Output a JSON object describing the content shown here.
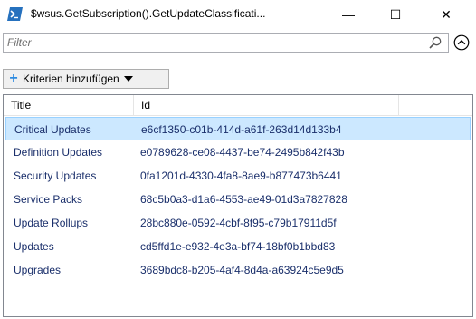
{
  "window": {
    "title": "$wsus.GetSubscription().GetUpdateClassificati...",
    "minimize_glyph": "—",
    "maximize_glyph": "☐",
    "close_glyph": "✕"
  },
  "filter": {
    "placeholder": "Filter",
    "value": "",
    "search_icon": "search-icon",
    "collapse_icon": "chevron-up-circle-icon"
  },
  "criteria": {
    "label": "Kriterien hinzufügen",
    "icon": "plus-icon",
    "plus_glyph": "+"
  },
  "grid": {
    "columns": [
      "Title",
      "Id",
      ""
    ],
    "rows": [
      {
        "title": "Critical Updates",
        "id": "e6cf1350-c01b-414d-a61f-263d14d133b4",
        "selected": true
      },
      {
        "title": "Definition Updates",
        "id": "e0789628-ce08-4437-be74-2495b842f43b",
        "selected": false
      },
      {
        "title": "Security Updates",
        "id": "0fa1201d-4330-4fa8-8ae9-b877473b6441",
        "selected": false
      },
      {
        "title": "Service Packs",
        "id": "68c5b0a3-d1a6-4553-ae49-01d3a7827828",
        "selected": false
      },
      {
        "title": "Update Rollups",
        "id": "28bc880e-0592-4cbf-8f95-c79b17911d5f",
        "selected": false
      },
      {
        "title": "Updates",
        "id": "cd5ffd1e-e932-4e3a-bf74-18bf0b1bbd83",
        "selected": false
      },
      {
        "title": "Upgrades",
        "id": "3689bdc8-b205-4af4-8d4a-a63924c5e9d5",
        "selected": false
      }
    ]
  },
  "colors": {
    "selection_bg": "#cce8ff",
    "selection_border": "#99d1ff",
    "row_text": "#1a2f6b",
    "accent": "#2e8be0"
  }
}
